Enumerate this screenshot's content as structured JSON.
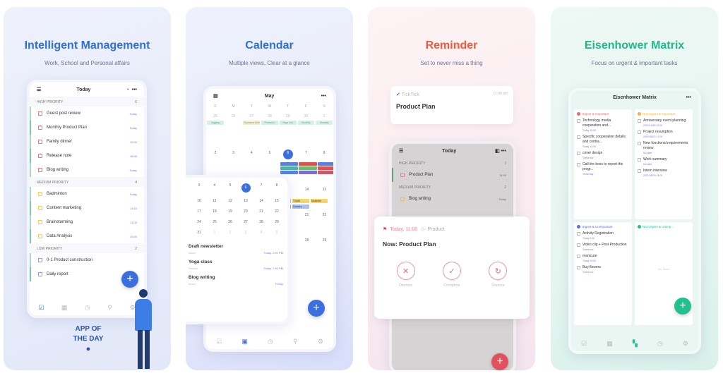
{
  "colors": {
    "blue": "#3b6fe0",
    "red": "#f0593e",
    "green": "#20c08f",
    "high": "#e07b7b",
    "medium": "#f2c94c",
    "low": "#8b9ae0"
  },
  "panel1": {
    "title": "Intelligent Management",
    "subtitle": "Work, School and Personal affairs",
    "screen": {
      "title": "Today",
      "sections": [
        {
          "name": "HIGH PRIORITY",
          "count": "6",
          "priority": "high",
          "items": [
            {
              "t": "Guest post review",
              "d": "Today"
            },
            {
              "t": "Monthly Product Plan",
              "d": "Today"
            },
            {
              "t": "Family dinner",
              "d": "19:00"
            },
            {
              "t": "Release note",
              "d": "18:00"
            },
            {
              "t": "Blog writing",
              "d": "Today"
            }
          ]
        },
        {
          "name": "MEDIUM PRIORITY",
          "count": "4",
          "priority": "medium",
          "items": [
            {
              "t": "Badminton",
              "d": "Today"
            },
            {
              "t": "Content marketing",
              "d": "14:10"
            },
            {
              "t": "Brainstorming",
              "d": "11:00"
            },
            {
              "t": "Data Analysis",
              "d": "10:00"
            }
          ]
        },
        {
          "name": "LOW PRIORITY",
          "count": "2",
          "priority": "low",
          "items": [
            {
              "t": "0-1 Product construction",
              "d": ""
            },
            {
              "t": "Daily report",
              "d": ""
            }
          ]
        }
      ]
    },
    "badge": {
      "line1": "APP OF",
      "line2": "THE DAY"
    }
  },
  "panel2": {
    "title": "Calendar",
    "subtitle": "Multiple views, Clear at a glance",
    "month": "May",
    "weekdays": [
      "S",
      "M",
      "T",
      "W",
      "T",
      "F",
      "S"
    ],
    "week1": [
      "25",
      "26",
      "27",
      "28",
      "29",
      "30",
      "1"
    ],
    "week2": [
      "2",
      "3",
      "4",
      "5",
      "6",
      "7",
      "8"
    ],
    "events1": [
      "Jogging",
      "",
      "Sponsors Marketing",
      "Product p",
      "Yoga clas",
      "Monthly",
      "Monthly"
    ],
    "mini": {
      "rows": [
        [
          "3",
          "4",
          "5",
          "6",
          "7",
          "8"
        ],
        [
          "10",
          "11",
          "12",
          "13",
          "14",
          "15"
        ],
        [
          "17",
          "18",
          "19",
          "20",
          "21",
          "22"
        ],
        [
          "24",
          "25",
          "26",
          "27",
          "28",
          "29"
        ],
        [
          "31",
          "1",
          "2",
          "3",
          "4",
          "5"
        ]
      ],
      "selected": "6",
      "tasks": [
        {
          "t": "Draft newsletter",
          "s": "Inbox",
          "d": "Today, 2:00 PM"
        },
        {
          "t": "Yoga class",
          "s": "Fitness",
          "d": "Today, 7:30 PM"
        },
        {
          "t": "Blog writing",
          "s": "Inbox",
          "d": "Friday"
        }
      ]
    },
    "right_days": [
      "14",
      "15",
      "21",
      "22",
      "28",
      "29"
    ],
    "extra_events": [
      "Feedback",
      "T-shirt",
      "Musician",
      "Good tea",
      "Grocery"
    ]
  },
  "panel3": {
    "title": "Reminder",
    "subtitle": "Set to never miss a thing",
    "notification": {
      "app": "TickTick",
      "time": "11:00 am",
      "title": "Product Plan"
    },
    "screen": {
      "title": "Today",
      "high": "HIGH PRIORITY",
      "high_count": "1",
      "task1": "Product Plan",
      "task1_time": "11:00",
      "medium": "MEDIUM PRIORITY",
      "medium_count": "2",
      "task2": "Blog writing",
      "task2_date": "Today"
    },
    "dialog": {
      "time": "Today, 11:00",
      "list": "Product",
      "title": "Now: Product Plan",
      "actions": [
        "Dismiss",
        "Complete",
        "Snooze"
      ]
    }
  },
  "panel4": {
    "title": "Eisenhower Matrix",
    "subtitle": "Focus on urgent & important tasks",
    "screen": {
      "title": "Eisenhower Matrix",
      "quadrants": [
        {
          "name": "Urgent & Important",
          "color": "#e86b6b",
          "items": [
            {
              "t": "Technology media cooperation and...",
              "d": "Today 10:00"
            },
            {
              "t": "Specific cooperation details and contra...",
              "d": "Today 15:00"
            },
            {
              "t": "cover design",
              "d": "Tomorrow"
            },
            {
              "t": "Call the boss to report the progr...",
              "d": "Yesterday"
            }
          ]
        },
        {
          "name": "Not Urgent & Important",
          "color": "#f2b33d",
          "items": [
            {
              "t": "Anniversary event planning",
              "d": "2021/10/08 10:00"
            },
            {
              "t": "Project resumption",
              "d": "2021/08/20 17:00"
            },
            {
              "t": "New functional requirements review",
              "d": "No date"
            },
            {
              "t": "Work summary",
              "d": "No date"
            },
            {
              "t": "Intern interview",
              "d": "2021/08/29 15:00"
            }
          ]
        },
        {
          "name": "Urgent & Unimportant",
          "color": "#5b6fe0",
          "items": [
            {
              "t": "Activity Registration",
              "d": "Today 9:00"
            },
            {
              "t": "Video clip + Post Production",
              "d": "Tomorrow"
            },
            {
              "t": "manicure",
              "d": "Today 19:30"
            },
            {
              "t": "Buy flowers",
              "d": "Tomorrow"
            }
          ]
        },
        {
          "name": "Not Urgent & Unimp...",
          "color": "#20c08f",
          "items": [],
          "empty": "No Tasks"
        }
      ]
    }
  }
}
